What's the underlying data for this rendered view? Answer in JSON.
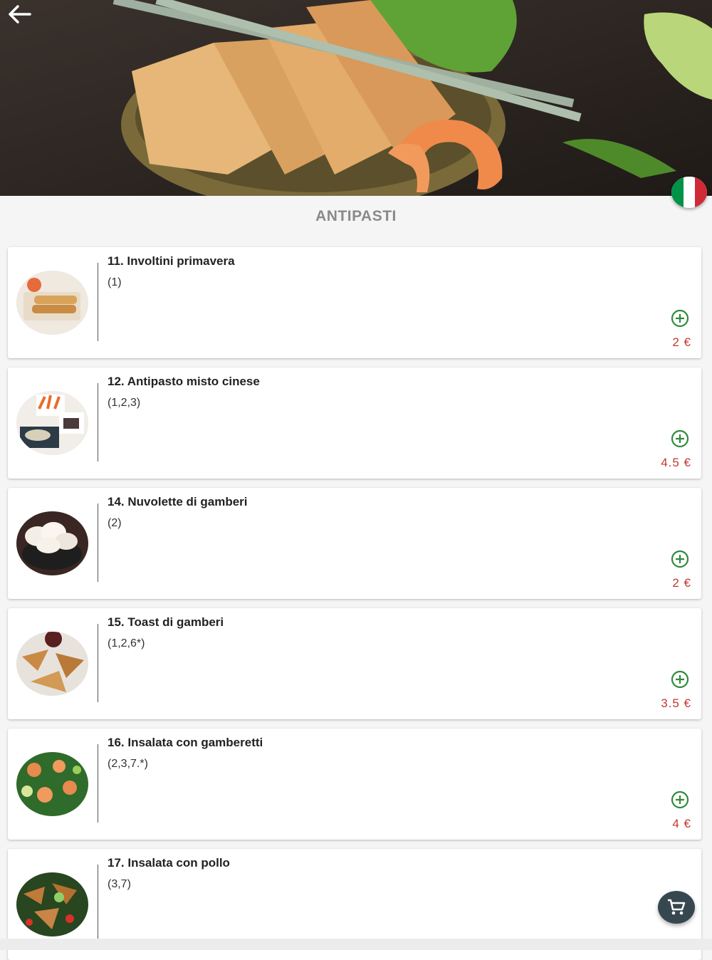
{
  "header": {
    "back_icon": "arrow-left-icon",
    "hero_image": "spring-rolls-with-chopsticks-and-shrimp",
    "language_icon": "italian-flag-icon",
    "flag_colors": [
      "#009246",
      "#ffffff",
      "#ce2b37"
    ]
  },
  "section": {
    "title": "ANTIPASTI"
  },
  "items": [
    {
      "name": "11. Involtini primavera",
      "allergens": "(1)",
      "price": "2 €",
      "image": "spring-rolls-photo"
    },
    {
      "name": "12. Antipasto misto cinese",
      "allergens": "(1,2,3)",
      "price": "4.5 €",
      "image": "mixed-appetizer-photo"
    },
    {
      "name": "14. Nuvolette di gamberi",
      "allergens": "(2)",
      "price": "2 €",
      "image": "prawn-crackers-photo"
    },
    {
      "name": "15. Toast di gamberi",
      "allergens": "(1,2,6*)",
      "price": "3.5 €",
      "image": "shrimp-toast-photo"
    },
    {
      "name": "16. Insalata con gamberetti",
      "allergens": "(2,3,7.*)",
      "price": "4 €",
      "image": "shrimp-salad-photo"
    },
    {
      "name": "17. Insalata con pollo",
      "allergens": "(3,7)",
      "price": "",
      "image": "chicken-salad-photo"
    }
  ],
  "cart": {
    "icon": "shopping-cart-icon"
  },
  "colors": {
    "price": "#c0392b",
    "add_icon": "#2e8b3a",
    "fab": "#37474f",
    "title": "#8a8a8a"
  }
}
